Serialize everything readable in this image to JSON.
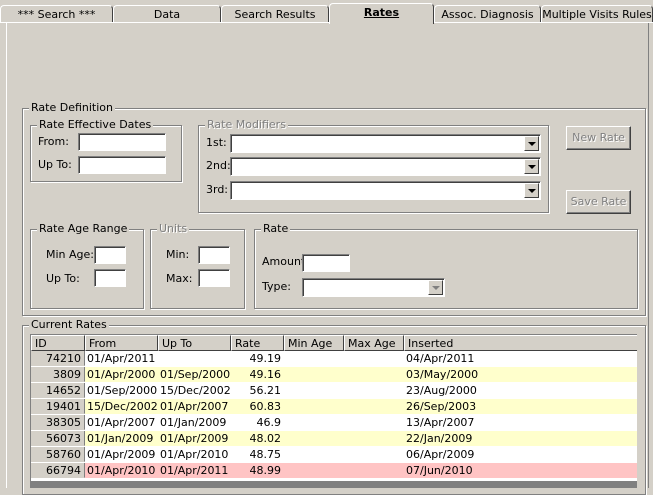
{
  "tabs": [
    {
      "label": "*** Search ***"
    },
    {
      "label": "Data"
    },
    {
      "label": "Search Results"
    },
    {
      "label": "Rates"
    },
    {
      "label": "Assoc. Diagnosis"
    },
    {
      "label": "Multiple Visits Rules"
    }
  ],
  "rate_definition": {
    "title": "Rate Definition",
    "effective_dates": {
      "title": "Rate Effective Dates",
      "from_label": "From:",
      "from_value": "",
      "upto_label": "Up To:",
      "upto_value": ""
    },
    "modifiers": {
      "title": "Rate Modifiers",
      "first_label": "1st:",
      "second_label": "2nd:",
      "third_label": "3rd:",
      "first_value": "",
      "second_value": "",
      "third_value": ""
    },
    "age_range": {
      "title": "Rate Age Range",
      "min_label": "Min Age:",
      "upto_label": "Up To:",
      "min_value": "",
      "upto_value": ""
    },
    "units": {
      "title": "Units",
      "min_label": "Min:",
      "max_label": "Max:",
      "min_value": "",
      "max_value": ""
    },
    "rate": {
      "title": "Rate",
      "amount_label": "Amount:",
      "type_label": "Type:",
      "amount_value": "",
      "type_value": ""
    },
    "new_rate_label": "New Rate",
    "save_rate_label": "Save Rate"
  },
  "current_rates": {
    "title": "Current Rates",
    "columns": [
      "ID",
      "From",
      "Up To",
      "Rate",
      "Min Age",
      "Max Age",
      "Inserted"
    ],
    "rows": [
      {
        "id": "74210",
        "from": "01/Apr/2011",
        "upto": "",
        "rate": "49.19",
        "min_age": "",
        "max_age": "",
        "inserted": "04/Apr/2011",
        "style": "white"
      },
      {
        "id": "3809",
        "from": "01/Apr/2000",
        "upto": "01/Sep/2000",
        "rate": "49.16",
        "min_age": "",
        "max_age": "",
        "inserted": "03/May/2000",
        "style": "yellow"
      },
      {
        "id": "14652",
        "from": "01/Sep/2000",
        "upto": "15/Dec/2002",
        "rate": "56.21",
        "min_age": "",
        "max_age": "",
        "inserted": "23/Aug/2000",
        "style": "white"
      },
      {
        "id": "19401",
        "from": "15/Dec/2002",
        "upto": "01/Apr/2007",
        "rate": "60.83",
        "min_age": "",
        "max_age": "",
        "inserted": "26/Sep/2003",
        "style": "yellow"
      },
      {
        "id": "38305",
        "from": "01/Apr/2007",
        "upto": "01/Jan/2009",
        "rate": "46.9",
        "min_age": "",
        "max_age": "",
        "inserted": "13/Apr/2007",
        "style": "white"
      },
      {
        "id": "56073",
        "from": "01/Jan/2009",
        "upto": "01/Apr/2009",
        "rate": "48.02",
        "min_age": "",
        "max_age": "",
        "inserted": "22/Jan/2009",
        "style": "yellow"
      },
      {
        "id": "58760",
        "from": "01/Apr/2009",
        "upto": "01/Apr/2010",
        "rate": "48.75",
        "min_age": "",
        "max_age": "",
        "inserted": "06/Apr/2009",
        "style": "white"
      },
      {
        "id": "66794",
        "from": "01/Apr/2010",
        "upto": "01/Apr/2011",
        "rate": "48.99",
        "min_age": "",
        "max_age": "",
        "inserted": "07/Jun/2010",
        "style": "pink"
      }
    ]
  },
  "colors": {
    "window_bg": "#d4d0c8",
    "row_white": "#ffffff",
    "row_yellow": "#ffffcc",
    "row_pink": "#ffc4c4"
  }
}
